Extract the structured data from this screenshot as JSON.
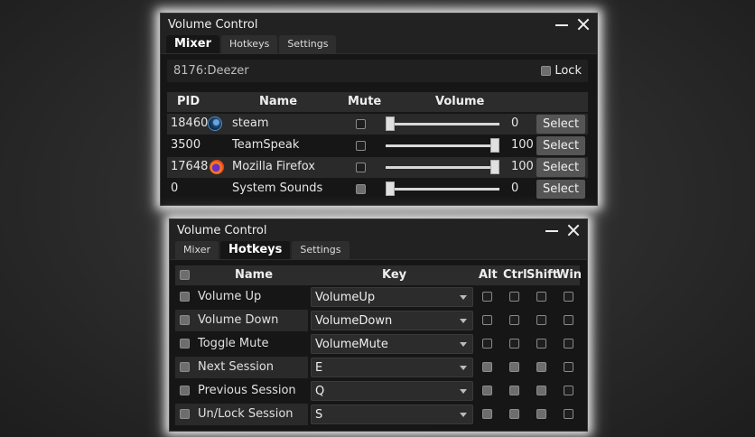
{
  "window1": {
    "title": "Volume Control",
    "tabs": [
      "Mixer",
      "Hotkeys",
      "Settings"
    ],
    "active_tab": "Mixer",
    "session": "8176:Deezer",
    "lock_label": "Lock",
    "lock_checked": false,
    "columns": [
      "PID",
      "Name",
      "Mute",
      "Volume"
    ],
    "rows": [
      {
        "pid": "18460",
        "name": "steam",
        "icon": "steam-icon",
        "muted": false,
        "volume": 0,
        "select": "Select"
      },
      {
        "pid": "3500",
        "name": "TeamSpeak",
        "icon": "",
        "muted": false,
        "volume": 100,
        "select": "Select"
      },
      {
        "pid": "17648",
        "name": "Mozilla Firefox",
        "icon": "firefox-icon",
        "muted": false,
        "volume": 100,
        "select": "Select"
      },
      {
        "pid": "0",
        "name": "System Sounds",
        "icon": "",
        "muted": true,
        "volume": 0,
        "select": "Select"
      }
    ]
  },
  "window2": {
    "title": "Volume Control",
    "tabs": [
      "Mixer",
      "Hotkeys",
      "Settings"
    ],
    "active_tab": "Hotkeys",
    "columns": [
      "Name",
      "Key",
      "Alt",
      "Ctrl",
      "Shift",
      "Win"
    ],
    "rows": [
      {
        "name": "Volume Up",
        "key": "VolumeUp",
        "alt": false,
        "ctrl": false,
        "shift": false,
        "win": false
      },
      {
        "name": "Volume Down",
        "key": "VolumeDown",
        "alt": false,
        "ctrl": false,
        "shift": false,
        "win": false
      },
      {
        "name": "Toggle Mute",
        "key": "VolumeMute",
        "alt": false,
        "ctrl": false,
        "shift": false,
        "win": false
      },
      {
        "name": "Next Session",
        "key": "E",
        "alt": true,
        "ctrl": true,
        "shift": true,
        "win": false
      },
      {
        "name": "Previous Session",
        "key": "Q",
        "alt": true,
        "ctrl": true,
        "shift": true,
        "win": false
      },
      {
        "name": "Un/Lock Session",
        "key": "S",
        "alt": true,
        "ctrl": true,
        "shift": true,
        "win": false
      }
    ]
  }
}
